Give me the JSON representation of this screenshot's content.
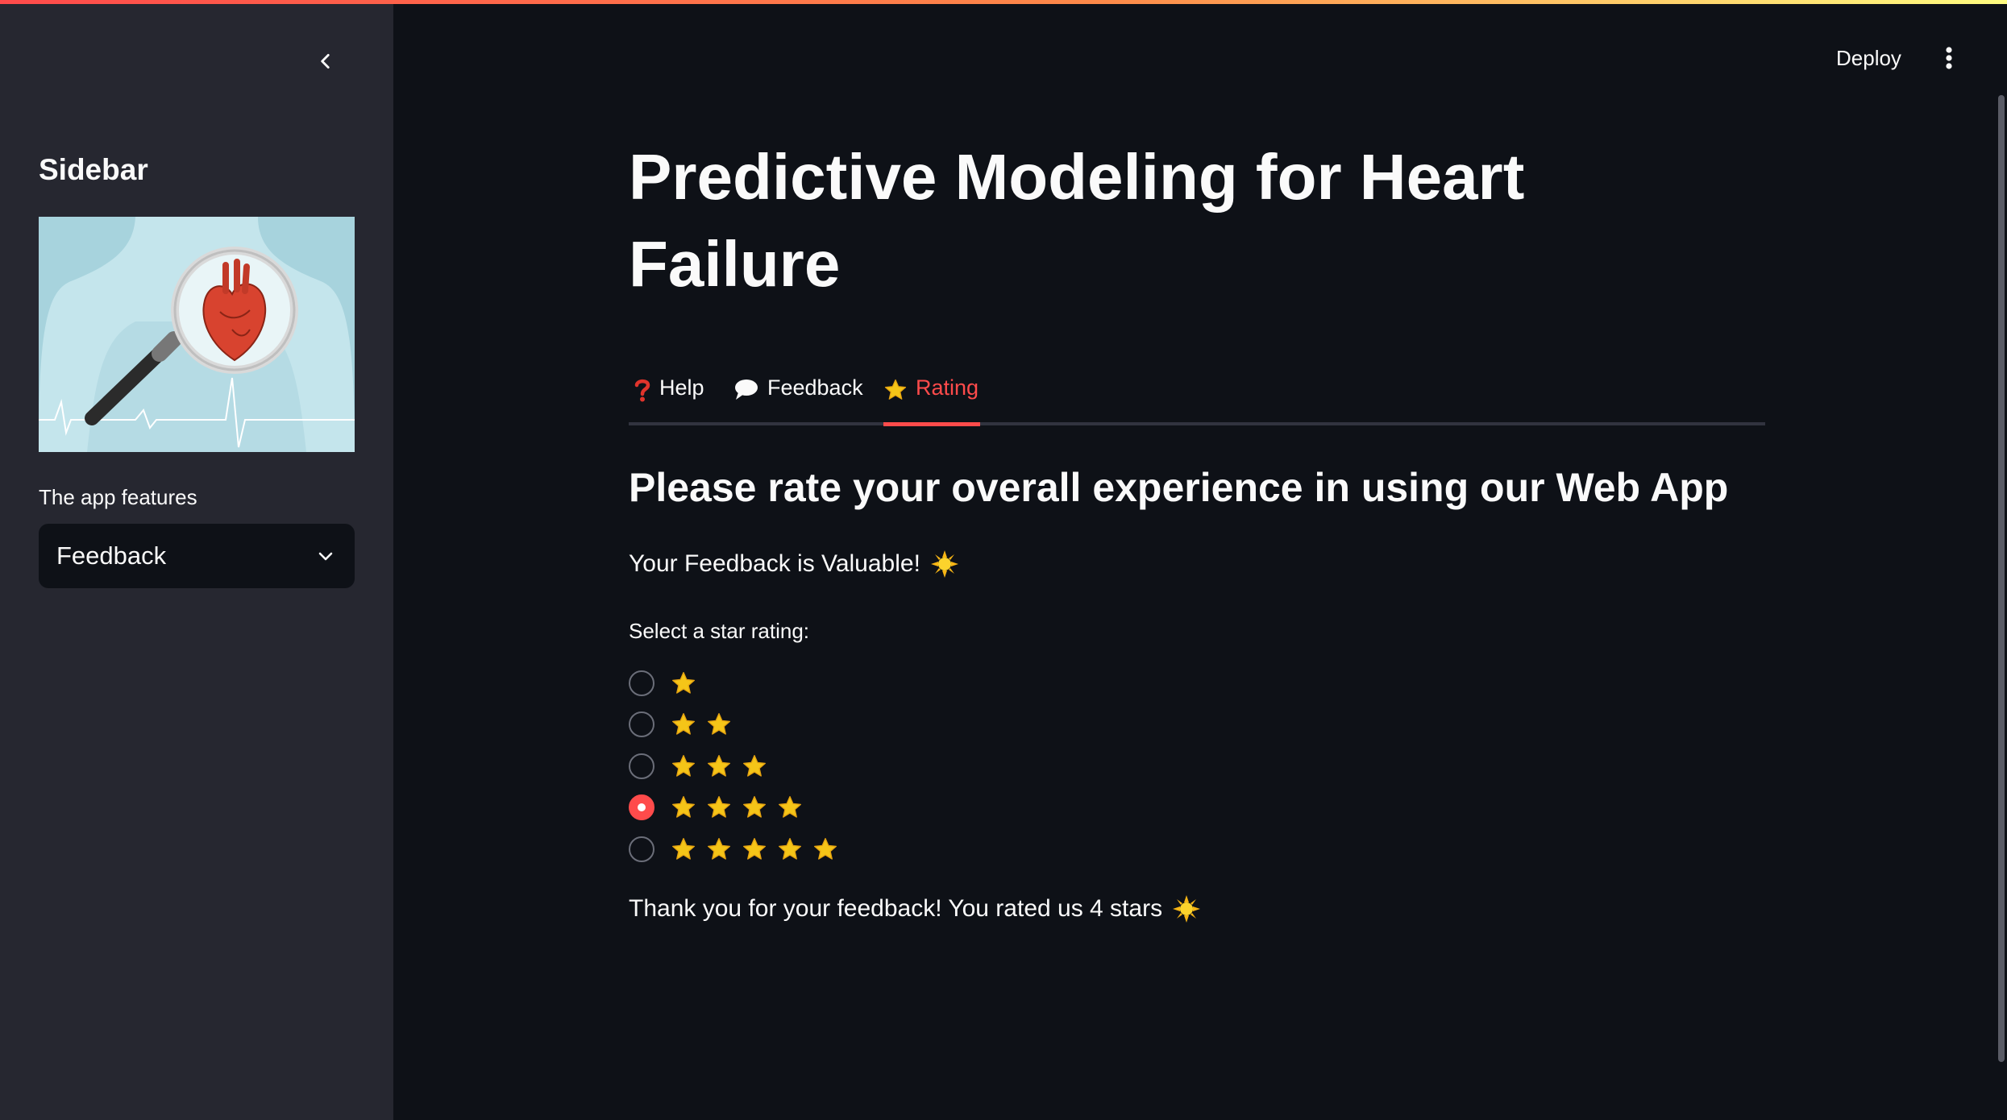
{
  "colors": {
    "accent": "#ff4b4b",
    "background": "#0e1117",
    "sidebar": "#262730",
    "star": "#f5c518"
  },
  "sidebar": {
    "title": "Sidebar",
    "features_label": "The app features",
    "selected_feature": "Feedback",
    "image_icon": "heart-magnifier-illustration"
  },
  "header": {
    "deploy_label": "Deploy",
    "menu_icon": "vertical-dots-icon"
  },
  "main": {
    "title": "Predictive Modeling for Heart Failure",
    "tabs": [
      {
        "label": "Help",
        "icon": "question-icon"
      },
      {
        "label": "Feedback",
        "icon": "speech-bubble-icon"
      },
      {
        "label": "Rating",
        "icon": "star-icon",
        "active": true
      }
    ],
    "heading": "Please rate your overall experience in using our Web App",
    "valuable_text": "Your Feedback is Valuable!",
    "rating_label": "Select a star rating:",
    "rating_options": [
      1,
      2,
      3,
      4,
      5
    ],
    "selected_rating": 4,
    "thanks_text": "Thank you for your feedback! You rated us 4 stars"
  }
}
